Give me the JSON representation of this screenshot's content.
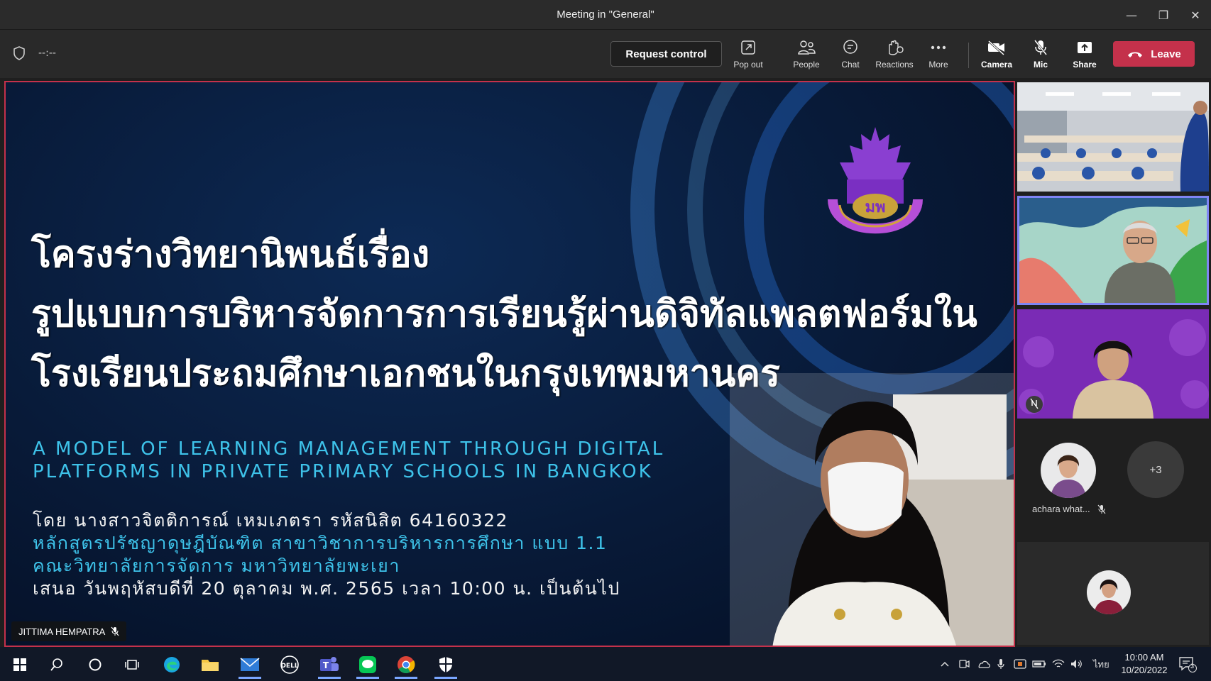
{
  "window": {
    "title": "Meeting in \"General\"",
    "min_glyph": "—",
    "max_glyph": "❐",
    "close_glyph": "✕"
  },
  "toolbar": {
    "timer": "--:--",
    "request_control_label": "Request control",
    "pop_out_label": "Pop out",
    "people_label": "People",
    "chat_label": "Chat",
    "reactions_label": "Reactions",
    "more_label": "More",
    "camera_label": "Camera",
    "mic_label": "Mic",
    "share_label": "Share",
    "leave_label": "Leave"
  },
  "slide": {
    "thai_title_1": "โครงร่างวิทยานิพนธ์เรื่อง",
    "thai_title_2": "รูปแบบการบริหารจัดการการเรียนรู้ผ่านดิจิทัลแพลตฟอร์มใน",
    "thai_title_3": "โรงเรียนประถมศึกษาเอกชนในกรุงเทพมหานคร",
    "en_line_1": "A MODEL OF LEARNING MANAGEMENT THROUGH DIGITAL",
    "en_line_2": "PLATFORMS IN PRIVATE PRIMARY SCHOOLS IN BANGKOK",
    "info_1": "โดย นางสาวจิตติการณ์ เหมเภตรา รหัสนิสิต 64160322",
    "info_2": "หลักสูตรปรัชญาดุษฎีบัณฑิต สาขาวิชาการบริหารการศึกษา แบบ 1.1",
    "info_3": "คณะวิทยาลัยการจัดการ มหาวิทยาลัยพะเยา",
    "info_4": "เสนอ วันพฤหัสบดีที่ 20 ตุลาคม พ.ศ. 2565 เวลา 10:00 น. เป็นต้นไป",
    "presenter_name": "JITTIMA HEMPATRA"
  },
  "participants": {
    "avatar_name": "achara what...",
    "overflow_count": "+3"
  },
  "taskbar": {
    "language": "ไทย",
    "time": "10:00 AM",
    "date": "10/20/2022",
    "notif_count": "3"
  },
  "colors": {
    "accent_leave": "#c4314b",
    "active_speaker": "#7f85f5",
    "slide_cyan": "#3ec3ea"
  }
}
